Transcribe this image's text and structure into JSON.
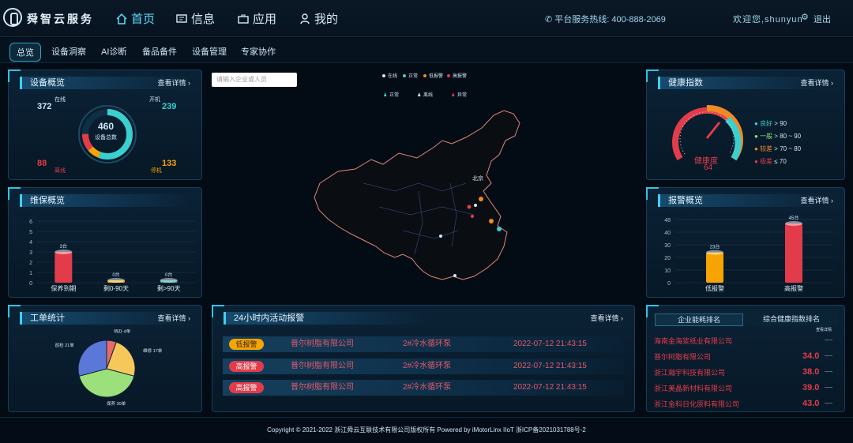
{
  "header": {
    "brand": "舜智云服务",
    "nav": [
      {
        "label": "首页",
        "icon": "home-icon"
      },
      {
        "label": "信息",
        "icon": "message-icon"
      },
      {
        "label": "应用",
        "icon": "app-icon"
      },
      {
        "label": "我的",
        "icon": "user-icon"
      }
    ],
    "hotline_label": "平台服务热线: 400-888-2069",
    "welcome": "欢迎您,shunyun",
    "logout": "退出"
  },
  "tabs": [
    "总览",
    "设备洞察",
    "AI诊断",
    "备品备件",
    "设备管理",
    "专家协作"
  ],
  "map": {
    "search_placeholder": "请输入企业或人员",
    "legend_status": [
      "在线",
      "正常",
      "低报警",
      "高报警"
    ],
    "legend_people": [
      "正常",
      "离线",
      "异常"
    ],
    "legend_colors": [
      "#cfe6f5",
      "#3ad0d0",
      "#f08a24",
      "#e23c4a"
    ],
    "city_label": "北京"
  },
  "device": {
    "title": "设备概览",
    "more": "查看详情",
    "online_label": "在线",
    "online": "372",
    "running_label": "开机",
    "running": "239",
    "offline_label": "离线",
    "offline": "88",
    "stopped_label": "停机",
    "stopped": "133",
    "total": "460",
    "total_label": "设备总数"
  },
  "maintenance": {
    "title": "维保概览",
    "chart_data": {
      "type": "bar",
      "categories": [
        "保养到期",
        "剩0-90天",
        "剩>90天"
      ],
      "values": [
        3,
        0,
        0
      ],
      "ylim": [
        0,
        6
      ],
      "yticks": [
        "6",
        "5",
        "4",
        "3",
        "2",
        "1",
        "0"
      ],
      "colors": [
        "#e23c4a",
        "#f5a400",
        "#21a5a0"
      ]
    },
    "value_labels": [
      "3台",
      "0台",
      "0台"
    ]
  },
  "workorder": {
    "title": "工单统计",
    "more": "查看详情",
    "chart_data": {
      "type": "pie",
      "labels": [
        "待办",
        "维修",
        "保养",
        "巡检"
      ],
      "values": [
        4,
        17,
        30,
        21
      ],
      "colors": [
        "#e86a6a",
        "#f6c85a",
        "#9be07a",
        "#5a78d8"
      ]
    },
    "slice_labels": [
      "待办 4单",
      "维修 17单",
      "保养 30单",
      "巡检 21单"
    ]
  },
  "alerts": {
    "title": "24小时内活动报警",
    "more": "查看详情",
    "rows": [
      {
        "level": "低报警",
        "color": "#f5a400",
        "company": "普尔树脂有限公司",
        "device": "2#冷水循环泵",
        "time": "2022-07-12 21:43:15"
      },
      {
        "level": "高报警",
        "color": "#e23c4a",
        "company": "普尔树脂有限公司",
        "device": "2#冷水循环泵",
        "time": "2022-07-12 21:43:15"
      },
      {
        "level": "高报警",
        "color": "#e23c4a",
        "company": "普尔树脂有限公司",
        "device": "2#冷水循环泵",
        "time": "2022-07-12 21:43:15"
      }
    ]
  },
  "health": {
    "title": "健康指数",
    "more": "查看详情",
    "gauge_label": "健康度",
    "gauge_value": "64",
    "gauge_fraction": 0.64,
    "legend": [
      {
        "name": "良好",
        "range": "> 90",
        "color": "#3ad0d0"
      },
      {
        "name": "一般",
        "range": "> 80 ~ 90",
        "color": "#9be07a"
      },
      {
        "name": "较差",
        "range": "> 70 ~ 80",
        "color": "#f08a24"
      },
      {
        "name": "极差",
        "range": "≤ 70",
        "color": "#e23c4a"
      }
    ]
  },
  "alarm_overview": {
    "title": "报警概览",
    "more": "查看详情",
    "chart_data": {
      "type": "bar",
      "categories": [
        "低报警",
        "高报警"
      ],
      "values": [
        23,
        45
      ],
      "ylim": [
        0,
        48
      ],
      "yticks": [
        "48",
        "40",
        "30",
        "20",
        "10",
        "0"
      ],
      "colors": [
        "#f5a400",
        "#e23c4a"
      ]
    },
    "value_labels": [
      "23台",
      "45台"
    ]
  },
  "ranking": {
    "tabs": [
      "企业能耗排名",
      "综合健康指数排名"
    ],
    "sub": "查看详情",
    "rows": [
      {
        "name": "海南金海浆纸业有限公司",
        "value": ""
      },
      {
        "name": "普尔树脂有限公司",
        "value": "34.0"
      },
      {
        "name": "浙江瀚宇科技有限公司",
        "value": "38.0"
      },
      {
        "name": "浙江美晶新材料有限公司",
        "value": "39.0"
      },
      {
        "name": "浙江金科日化原料有限公司",
        "value": "43.0"
      }
    ]
  },
  "footer": "Copyright © 2021-2022 浙江舜云互联技术有限公司版权所有    Powered by iMotorLinx IIoT    浙ICP备2021031788号-2"
}
